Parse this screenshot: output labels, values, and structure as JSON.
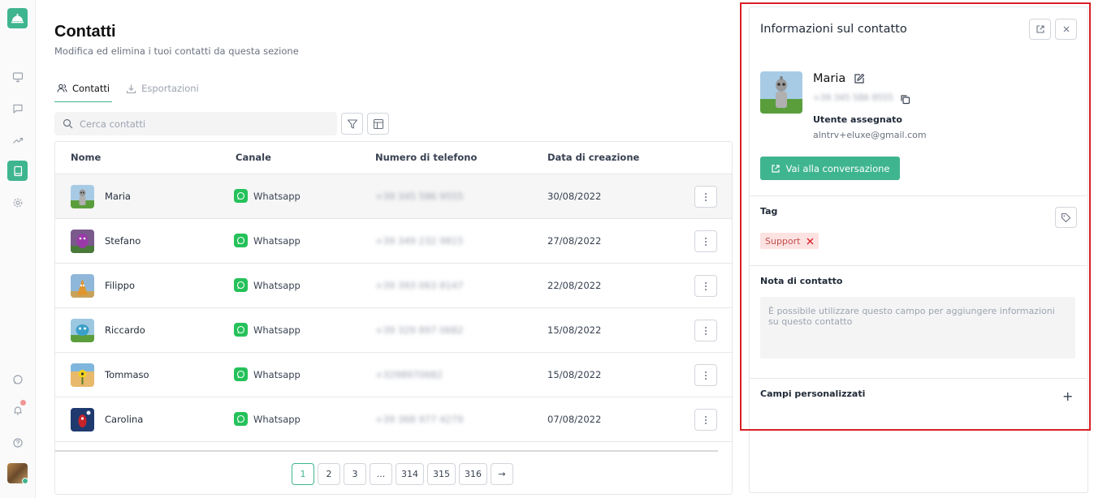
{
  "app": {
    "accent": "#3fb58f"
  },
  "sidebar": {
    "items": [
      {
        "icon": "monitor-icon"
      },
      {
        "icon": "chat-bubble-icon"
      },
      {
        "icon": "trending-up-icon"
      },
      {
        "icon": "contacts-book-icon",
        "active": true
      },
      {
        "icon": "gear-icon"
      },
      {
        "icon": "whatsapp-icon"
      },
      {
        "icon": "bell-icon"
      },
      {
        "icon": "help-icon"
      }
    ]
  },
  "main": {
    "title": "Contatti",
    "subtitle": "Modifica ed elimina i tuoi contatti da questa sezione",
    "tabs": [
      {
        "label": "Contatti",
        "active": true
      },
      {
        "label": "Esportazioni",
        "active": false
      }
    ],
    "search": {
      "placeholder": "Cerca contatti",
      "value": ""
    },
    "table": {
      "headers": [
        "Nome",
        "Canale",
        "Numero di telefono",
        "Data di creazione"
      ],
      "rows": [
        {
          "name": "Maria",
          "channel": "Whatsapp",
          "phone": "+39 345 586 9555",
          "date": "30/08/2022"
        },
        {
          "name": "Stefano",
          "channel": "Whatsapp",
          "phone": "+39 349 232 9815",
          "date": "27/08/2022"
        },
        {
          "name": "Filippo",
          "channel": "Whatsapp",
          "phone": "+39 393 063 8147",
          "date": "22/08/2022"
        },
        {
          "name": "Riccardo",
          "channel": "Whatsapp",
          "phone": "+39 329 897 0682",
          "date": "15/08/2022"
        },
        {
          "name": "Tommaso",
          "channel": "Whatsapp",
          "phone": "+3298970682",
          "date": "15/08/2022"
        },
        {
          "name": "Carolina",
          "channel": "Whatsapp",
          "phone": "+39 368 977 4279",
          "date": "07/08/2022"
        }
      ]
    },
    "pagination": {
      "pages": [
        "1",
        "2",
        "3",
        "...",
        "314",
        "315",
        "316"
      ],
      "current": "1",
      "next": "→"
    }
  },
  "panel": {
    "title": "Informazioni sul contatto",
    "contact": {
      "name": "Maria",
      "phone": "+39 345 586 9555",
      "assigned_label": "Utente assegnato",
      "assigned_email": "alntrv+eluxe@gmail.com"
    },
    "goto_label": "Vai alla conversazione",
    "tag_title": "Tag",
    "tags": [
      "Support"
    ],
    "note_title": "Nota di contatto",
    "note_placeholder": "È possibile utilizzare questo campo per aggiungere informazioni su questo contatto",
    "custom_fields_title": "Campi personalizzati",
    "add_symbol": "+",
    "highlight_color": "#d92027"
  }
}
